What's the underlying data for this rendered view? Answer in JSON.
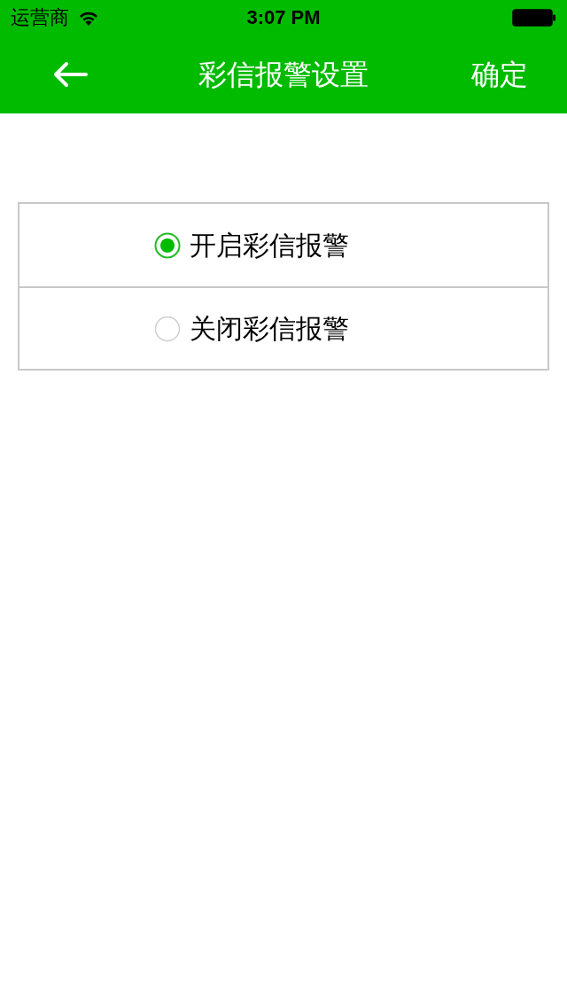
{
  "status_bar": {
    "carrier": "运营商",
    "time": "3:07 PM"
  },
  "nav_bar": {
    "title": "彩信报警设置",
    "confirm": "确定"
  },
  "options": [
    {
      "label": "开启彩信报警",
      "selected": true
    },
    {
      "label": "关闭彩信报警",
      "selected": false
    }
  ]
}
